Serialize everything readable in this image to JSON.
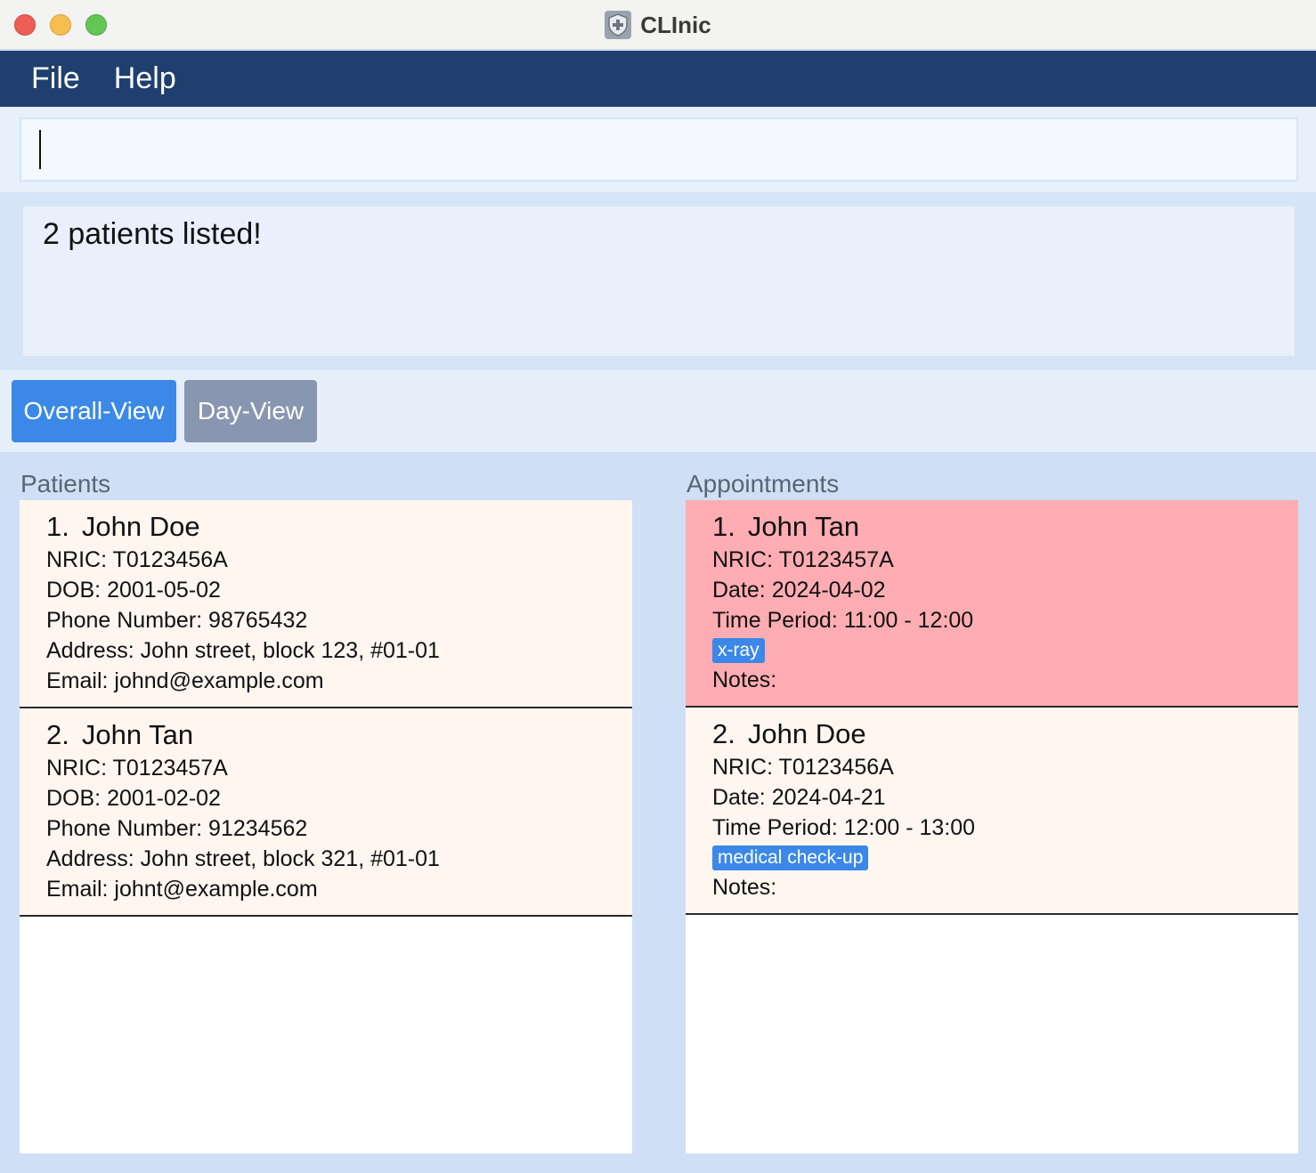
{
  "window": {
    "title": "CLInic",
    "icon": "shield-plus-icon"
  },
  "menu": {
    "file": "File",
    "help": "Help"
  },
  "command": {
    "value": "",
    "placeholder": ""
  },
  "result": {
    "message": "2 patients listed!"
  },
  "views": {
    "overall": "Overall-View",
    "day": "Day-View",
    "active": "Overall-View"
  },
  "patients": {
    "label": "Patients",
    "items": [
      {
        "index": "1.",
        "name": "John Doe",
        "nric": "NRIC: T0123456A",
        "dob": "DOB: 2001-05-02",
        "phone": "Phone Number: 98765432",
        "address": "Address: John street, block 123, #01-01",
        "email": "Email: johnd@example.com"
      },
      {
        "index": "2.",
        "name": "John Tan",
        "nric": "NRIC: T0123457A",
        "dob": "DOB: 2001-02-02",
        "phone": "Phone Number: 91234562",
        "address": "Address: John street, block 321, #01-01",
        "email": "Email: johnt@example.com"
      }
    ]
  },
  "appointments": {
    "label": "Appointments",
    "items": [
      {
        "index": "1.",
        "name": "John Tan",
        "nric": "NRIC: T0123457A",
        "date": "Date: 2024-04-02",
        "time": "Time Period: 11:00 - 12:00",
        "tag": "x-ray",
        "notes": "Notes:",
        "highlight": true
      },
      {
        "index": "2.",
        "name": "John Doe",
        "nric": "NRIC: T0123456A",
        "date": "Date: 2024-04-21",
        "time": "Time Period: 12:00 - 13:00",
        "tag": "medical check-up",
        "notes": "Notes:",
        "highlight": false
      }
    ]
  },
  "colors": {
    "menubar": "#1f3f6e",
    "accent": "#3b88e8",
    "inactive_button": "#8896b0",
    "card_bg": "#fff6f0",
    "highlight_bg": "#ffadb2"
  }
}
